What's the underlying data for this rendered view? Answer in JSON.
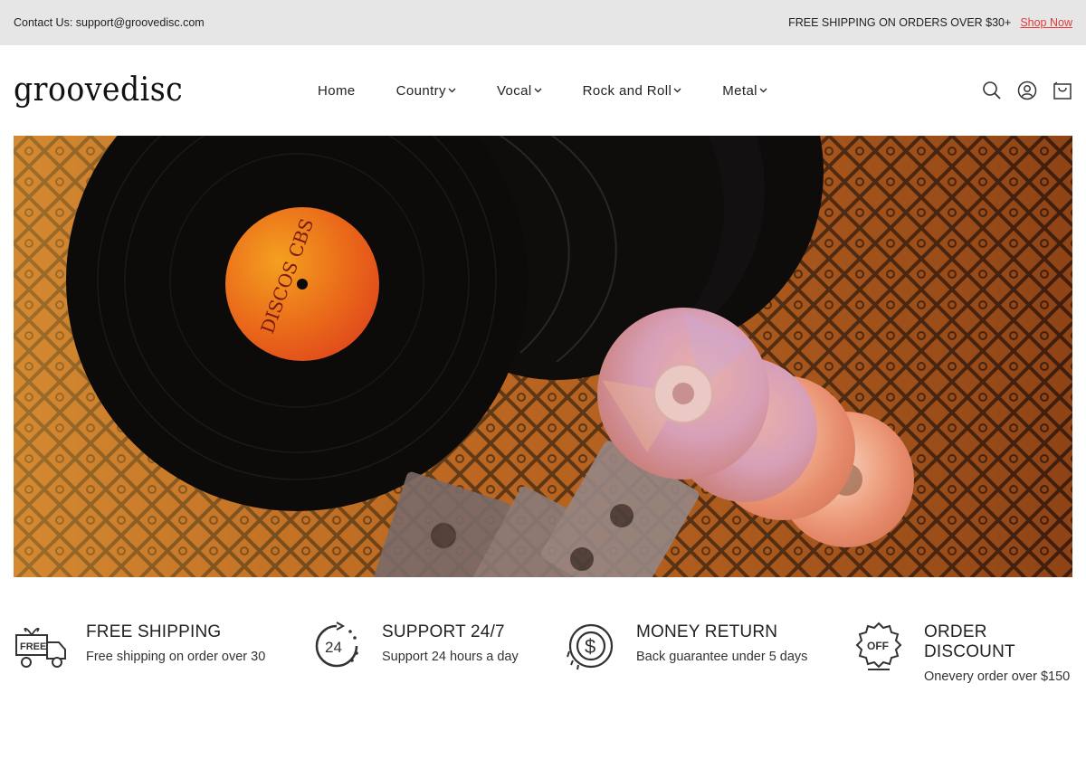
{
  "topbar": {
    "contact": "Contact Us: support@groovedisc.com",
    "promo": "FREE SHIPPING ON ORDERS OVER $30+",
    "shop_now": "Shop Now",
    "shop_now_color": "#e03a3a"
  },
  "header": {
    "logo": "groovedisc",
    "nav": [
      {
        "label": "Home",
        "has_dropdown": false
      },
      {
        "label": "Country",
        "has_dropdown": true
      },
      {
        "label": "Vocal",
        "has_dropdown": true
      },
      {
        "label": "Rock and Roll",
        "has_dropdown": true
      },
      {
        "label": "Metal",
        "has_dropdown": true
      }
    ],
    "icons": [
      "search-icon",
      "account-icon",
      "cart-icon"
    ]
  },
  "hero": {
    "record_label_text": "DISCOS CBS"
  },
  "features": [
    {
      "icon": "free-shipping-truck-icon",
      "title": "FREE SHIPPING",
      "desc": "Free shipping on order over 30"
    },
    {
      "icon": "support-24-icon",
      "title": "SUPPORT 24/7",
      "desc": "Support 24 hours a day"
    },
    {
      "icon": "money-return-icon",
      "title": "MONEY RETURN",
      "desc": "Back guarantee under 5 days"
    },
    {
      "icon": "order-discount-icon",
      "title": "ORDER DISCOUNT",
      "desc": "Onevery order over $150"
    }
  ]
}
